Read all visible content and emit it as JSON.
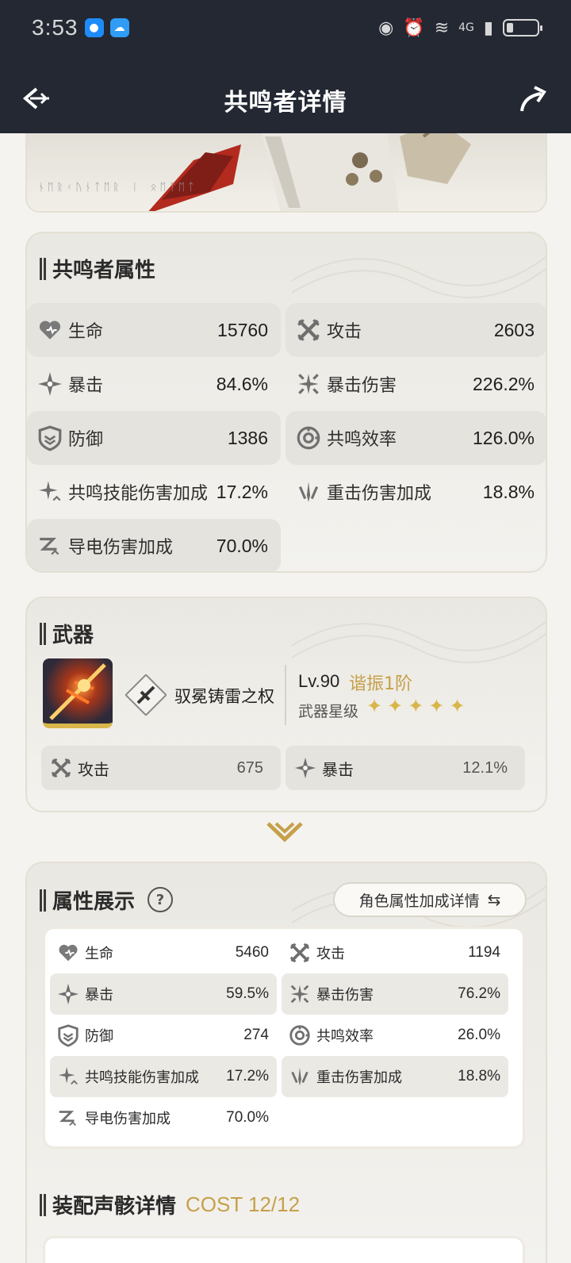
{
  "status_bar": {
    "time": "3:53",
    "network": "4G"
  },
  "header": {
    "title": "共鸣者详情"
  },
  "resonator_stats": {
    "title": "共鸣者属性",
    "items": [
      {
        "label": "生命",
        "value": "15760",
        "icon": "heart-icon"
      },
      {
        "label": "攻击",
        "value": "2603",
        "icon": "crossed-swords-icon"
      },
      {
        "label": "暴击",
        "value": "84.6%",
        "icon": "crit-star-icon"
      },
      {
        "label": "暴击伤害",
        "value": "226.2%",
        "icon": "crit-damage-icon"
      },
      {
        "label": "防御",
        "value": "1386",
        "icon": "shield-icon"
      },
      {
        "label": "共鸣效率",
        "value": "126.0%",
        "icon": "energy-regen-icon"
      },
      {
        "label": "共鸣技能伤害加成",
        "value": "17.2%",
        "icon": "skill-bonus-icon"
      },
      {
        "label": "重击伤害加成",
        "value": "18.8%",
        "icon": "heavy-attack-icon"
      },
      {
        "label": "导电伤害加成",
        "value": "70.0%",
        "icon": "electro-bonus-icon"
      }
    ]
  },
  "weapon": {
    "title": "武器",
    "name": "驭冕铸雷之权",
    "level": "Lv.90",
    "rank": "谐振1阶",
    "star_label": "武器星级",
    "stars": 5,
    "stats": [
      {
        "label": "攻击",
        "value": "675",
        "icon": "crossed-swords-icon"
      },
      {
        "label": "暴击",
        "value": "12.1%",
        "icon": "crit-star-icon"
      }
    ]
  },
  "attribute_display": {
    "title": "属性展示",
    "help_label": "?",
    "detail_button": "角色属性加成详情",
    "items": [
      {
        "label": "生命",
        "value": "5460",
        "icon": "heart-icon"
      },
      {
        "label": "攻击",
        "value": "1194",
        "icon": "crossed-swords-icon"
      },
      {
        "label": "暴击",
        "value": "59.5%",
        "icon": "crit-star-icon"
      },
      {
        "label": "暴击伤害",
        "value": "76.2%",
        "icon": "crit-damage-icon"
      },
      {
        "label": "防御",
        "value": "274",
        "icon": "shield-icon"
      },
      {
        "label": "共鸣效率",
        "value": "26.0%",
        "icon": "energy-regen-icon"
      },
      {
        "label": "共鸣技能伤害加成",
        "value": "17.2%",
        "icon": "skill-bonus-icon"
      },
      {
        "label": "重击伤害加成",
        "value": "18.8%",
        "icon": "heavy-attack-icon"
      },
      {
        "label": "导电伤害加成",
        "value": "70.0%",
        "icon": "electro-bonus-icon"
      }
    ]
  },
  "echo": {
    "title": "装配声骸详情",
    "cost": "COST 12/12"
  },
  "colors": {
    "header_bg": "#232833",
    "accent_gold": "#c6a04a",
    "panel_bg": "#eae8e2"
  }
}
